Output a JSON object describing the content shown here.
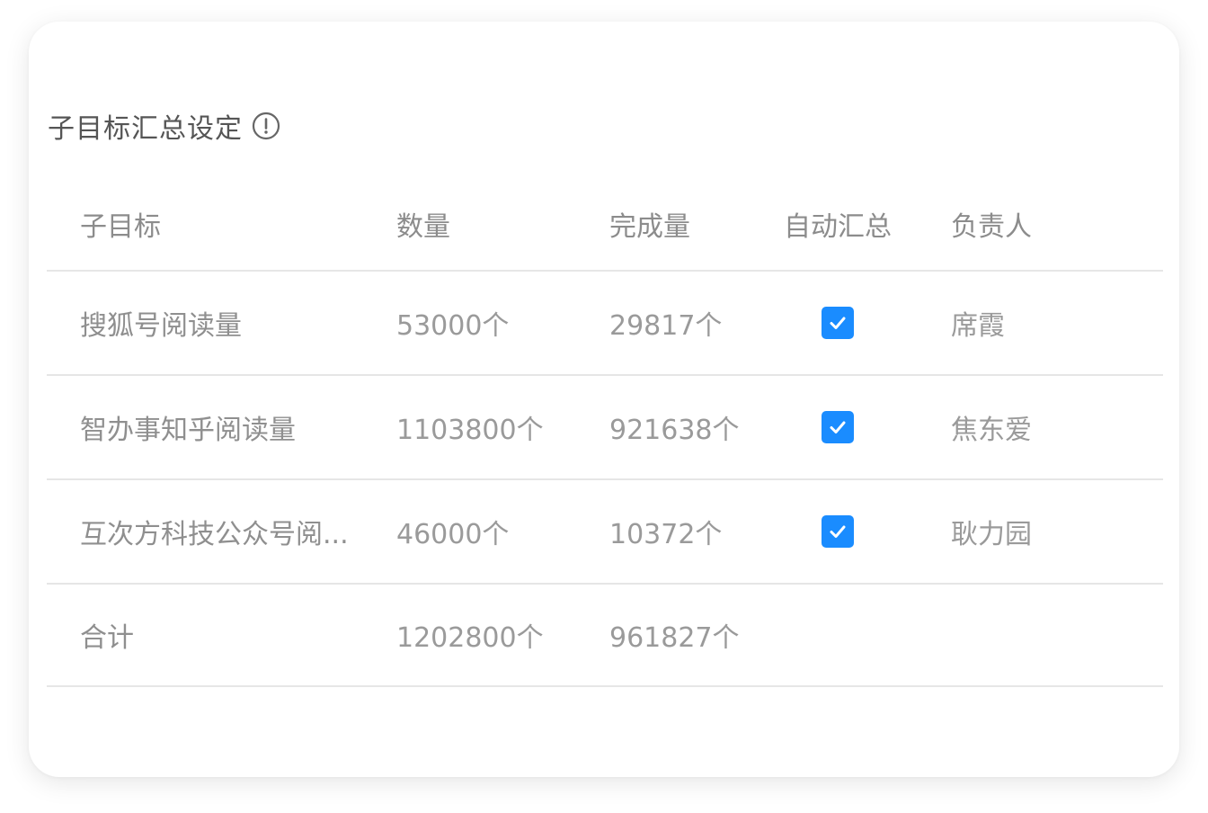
{
  "section": {
    "title": "子目标汇总设定",
    "info_icon": "info-circle-icon"
  },
  "table": {
    "headers": {
      "name": "子目标",
      "quantity": "数量",
      "completed": "完成量",
      "auto_summary": "自动汇总",
      "owner": "负责人"
    },
    "rows": [
      {
        "name": "搜狐号阅读量",
        "quantity": "53000个",
        "completed": "29817个",
        "auto_summary": true,
        "owner": "席霞"
      },
      {
        "name": "智办事知乎阅读量",
        "quantity": "1103800个",
        "completed": "921638个",
        "auto_summary": true,
        "owner": "焦东爱"
      },
      {
        "name": "互次方科技公众号阅...",
        "quantity": "46000个",
        "completed": "10372个",
        "auto_summary": true,
        "owner": "耿力园"
      }
    ],
    "total": {
      "label": "合计",
      "quantity": "1202800个",
      "completed": "961827个"
    }
  },
  "colors": {
    "checkbox": "#1a8cff",
    "divider": "#e6e6e6"
  }
}
